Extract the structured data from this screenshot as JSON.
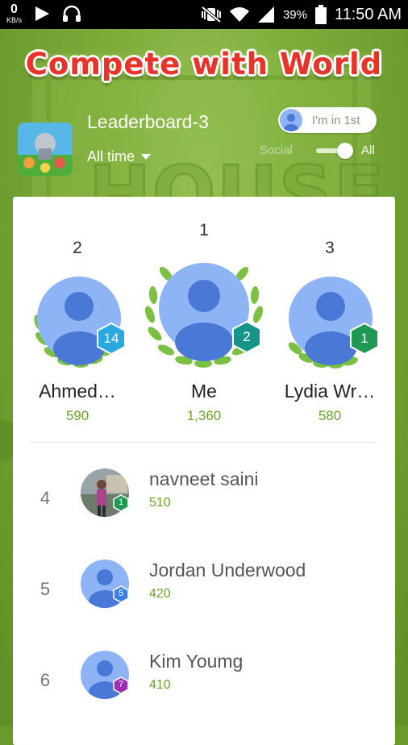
{
  "status_bar": {
    "speed_value": "0",
    "speed_unit": "KB/s",
    "battery_pct": "39%",
    "time": "11:50 AM"
  },
  "header": {
    "title": "Compete with World",
    "leaderboard_name": "Leaderboard-3",
    "time_filter": "All time",
    "rank_pill": "I'm in 1st",
    "toggle_left": "Social",
    "toggle_right": "All",
    "toggle_state": "All"
  },
  "background_word": "HOUSE",
  "podium": [
    {
      "rank": "2",
      "name": "Ahmed…",
      "score": "590",
      "level": "14",
      "level_color": "#29a9e0"
    },
    {
      "rank": "1",
      "name": "Me",
      "score": "1,360",
      "level": "2",
      "level_color": "#16948a"
    },
    {
      "rank": "3",
      "name": "Lydia Wr…",
      "score": "580",
      "level": "1",
      "level_color": "#1e9a55"
    }
  ],
  "rows": [
    {
      "rank": "4",
      "name": "navneet saini",
      "score": "510",
      "level": "1",
      "level_color": "#1e9a55",
      "avatar": "photo"
    },
    {
      "rank": "5",
      "name": "Jordan Underwood",
      "score": "420",
      "level": "5",
      "level_color": "#3a7fe0",
      "avatar": "default"
    },
    {
      "rank": "6",
      "name": "Kim Youmg",
      "score": "410",
      "level": "7",
      "level_color": "#9b2fb0",
      "avatar": "default"
    }
  ],
  "colors": {
    "accent_green": "#6aa32b",
    "avatar_blue": "#8fb4f5",
    "title_red": "#e8332a"
  }
}
